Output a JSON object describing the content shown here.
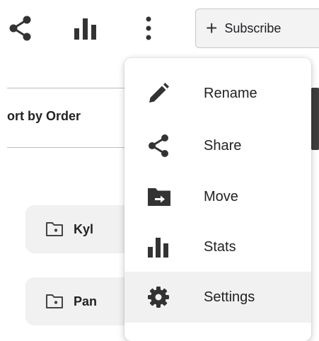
{
  "toolbar": {
    "share_icon": "share-icon",
    "stats_icon": "bar-chart-icon",
    "more_icon": "more-vert-icon",
    "subscribe_label": "Subscribe"
  },
  "list": {
    "sort_label": "ort by Order",
    "folders": [
      {
        "name": "Kyl",
        "icon": "folder-icon"
      },
      {
        "name": "Pan",
        "icon": "folder-icon"
      }
    ]
  },
  "menu": {
    "items": [
      {
        "label": "Rename",
        "icon": "pencil-icon"
      },
      {
        "label": "Share",
        "icon": "share-icon"
      },
      {
        "label": "Move",
        "icon": "move-folder-icon"
      },
      {
        "label": "Stats",
        "icon": "bar-chart-icon"
      },
      {
        "label": "Settings",
        "icon": "gear-icon",
        "hovered": true
      }
    ]
  },
  "colors": {
    "icon": "#333333",
    "menu_hover": "#f1f1f1",
    "scrollbar": "#3d3d3d"
  }
}
